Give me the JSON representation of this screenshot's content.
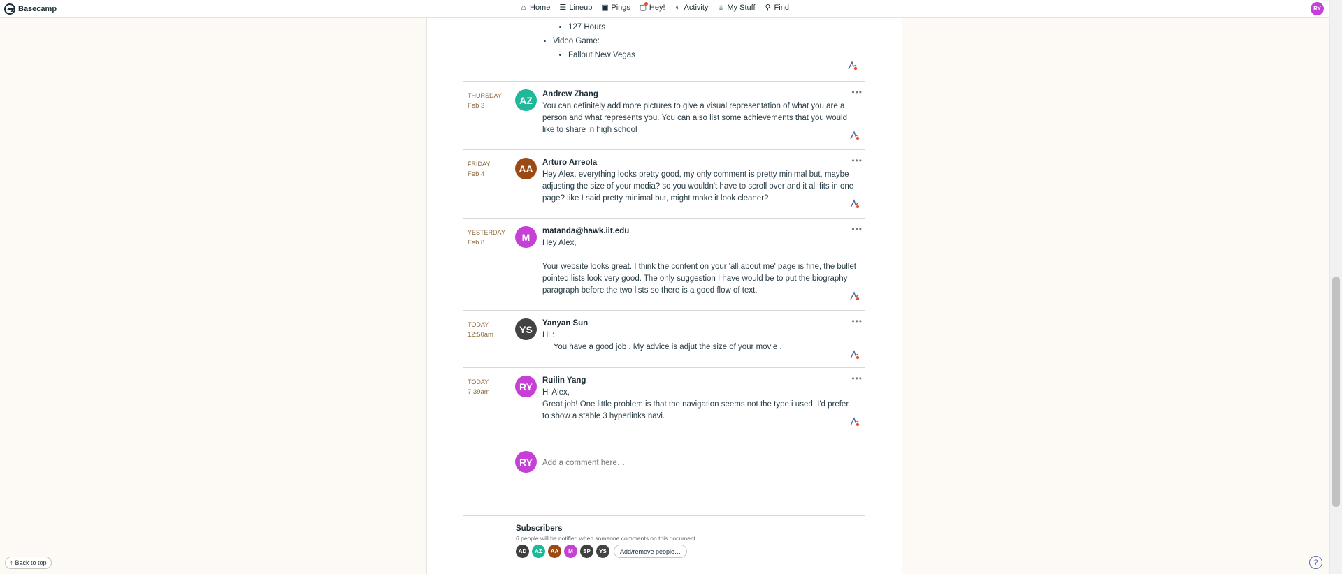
{
  "app": {
    "name": "Basecamp"
  },
  "nav": [
    {
      "label": "Home",
      "icon": "home-icon"
    },
    {
      "label": "Lineup",
      "icon": "lineup-icon"
    },
    {
      "label": "Pings",
      "icon": "pings-icon"
    },
    {
      "label": "Hey!",
      "icon": "hey-icon"
    },
    {
      "label": "Activity",
      "icon": "activity-icon"
    },
    {
      "label": "My Stuff",
      "icon": "my-stuff-icon"
    },
    {
      "label": "Find",
      "icon": "find-icon"
    }
  ],
  "user": {
    "initials": "RY",
    "color": "#c63fd6"
  },
  "previous_list": {
    "item_1": "127 Hours",
    "label_2": "Video Game:",
    "item_2": "Fallout New Vegas"
  },
  "comments": [
    {
      "day": "THURSDAY",
      "date": "Feb 3",
      "initials": "AZ",
      "color": "#1fb89b",
      "author": "Andrew Zhang",
      "body": "You can definitely add more pictures to give a visual representation of what you are a person and what represents you. You can also list some achievements that you would like to share in high school"
    },
    {
      "day": "FRIDAY",
      "date": "Feb 4",
      "initials": "AA",
      "color": "#9b4a14",
      "author": "Arturo Arreola",
      "body": "Hey Alex, everything looks pretty good, my only comment is pretty minimal but, maybe adjusting the size of your media? so you wouldn't have to scroll over and it all fits in one page? like I said pretty minimal but, might make it look cleaner?"
    },
    {
      "day": "YESTERDAY",
      "date": "Feb 8",
      "initials": "M",
      "color": "#c63fd6",
      "author": "matanda@hawk.iit.edu",
      "body": "Hey Alex,\n\nYour website looks great. I think the content on your 'all about me' page is fine, the bullet pointed lists look very good. The only suggestion I have would be to put the biography paragraph before the two lists so there is a good flow of text."
    },
    {
      "day": "TODAY",
      "date": "12:50am",
      "initials": "YS",
      "color": "#434343",
      "author": "Yanyan Sun",
      "body": "Hi :\n     You have a good job . My advice is adjut the size of your movie ."
    },
    {
      "day": "TODAY",
      "date": "7:39am",
      "initials": "RY",
      "color": "#c63fd6",
      "author": "Ruilin Yang",
      "body": "Hi Alex,\nGreat job! One little problem is that the navigation seems not the type i used. I'd prefer to show a stable 3 hyperlinks navi."
    }
  ],
  "comment_menu": "•••",
  "add_comment": {
    "placeholder": "Add a comment here…",
    "initials": "RY"
  },
  "subscribers": {
    "title": "Subscribers",
    "note": "6 people will be notified when someone comments on this document.",
    "people": [
      {
        "initials": "AD",
        "color": "#3f3f3f"
      },
      {
        "initials": "AZ",
        "color": "#1fb89b"
      },
      {
        "initials": "AA",
        "color": "#9b4a14"
      },
      {
        "initials": "M",
        "color": "#c63fd6"
      },
      {
        "initials": "SP",
        "color": "#3f3f3f"
      },
      {
        "initials": "YS",
        "color": "#434343"
      }
    ],
    "add_remove": "Add/remove people…"
  },
  "back_to_top": "Back to top",
  "help": "?"
}
